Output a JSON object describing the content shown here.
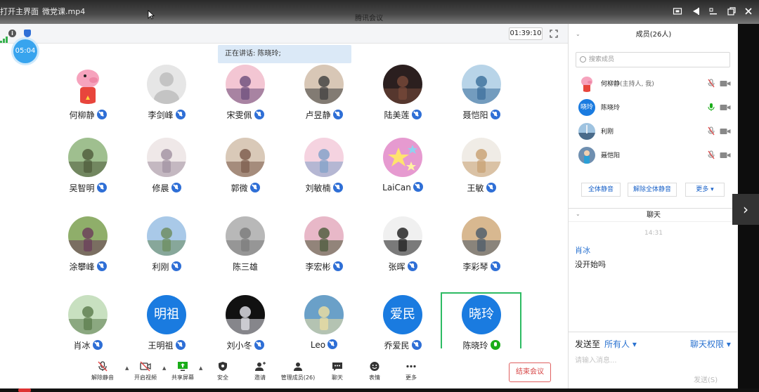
{
  "player": {
    "open_main": "打开主界面",
    "file_name": "微党课.mp4"
  },
  "app_title": "腾讯会议",
  "meeting": {
    "duration": "01:39:10",
    "timer_badge": "05:04",
    "speaking_banner": "正在讲话: 陈晓玲;"
  },
  "participants": [
    {
      "name": "何柳静",
      "mic": "muted",
      "avatar": "peppa"
    },
    {
      "name": "李剑峰",
      "mic": "muted",
      "avatar": "default"
    },
    {
      "name": "宋雯佩",
      "mic": "muted",
      "avatar": "photo"
    },
    {
      "name": "卢昱静",
      "mic": "muted",
      "avatar": "photo"
    },
    {
      "name": "陆美莲",
      "mic": "muted",
      "avatar": "photo"
    },
    {
      "name": "聂恺阳",
      "mic": "muted",
      "avatar": "photo"
    },
    {
      "name": "吴智明",
      "mic": "muted",
      "avatar": "photo"
    },
    {
      "name": "修晨",
      "mic": "muted",
      "avatar": "photo"
    },
    {
      "name": "郭微",
      "mic": "muted",
      "avatar": "photo"
    },
    {
      "name": "刘敏楠",
      "mic": "muted",
      "avatar": "photo"
    },
    {
      "name": "LaiCan",
      "mic": "muted",
      "avatar": "stars"
    },
    {
      "name": "王敏",
      "mic": "muted",
      "avatar": "photo"
    },
    {
      "name": "涂攀峰",
      "mic": "muted",
      "avatar": "photo"
    },
    {
      "name": "利刚",
      "mic": "muted",
      "avatar": "photo"
    },
    {
      "name": "陈三雄",
      "mic": "none",
      "avatar": "photo"
    },
    {
      "name": "李宏彬",
      "mic": "muted",
      "avatar": "photo"
    },
    {
      "name": "张晖",
      "mic": "muted",
      "avatar": "photo"
    },
    {
      "name": "李彩琴",
      "mic": "muted",
      "avatar": "photo"
    },
    {
      "name": "肖冰",
      "mic": "muted",
      "avatar": "photo"
    },
    {
      "name": "王明祖",
      "mic": "muted",
      "avatar": "text",
      "avatar_text": "明祖"
    },
    {
      "name": "刘小冬",
      "mic": "muted",
      "avatar": "photo"
    },
    {
      "name": "Leo",
      "mic": "muted",
      "avatar": "photo"
    },
    {
      "name": "乔爱民",
      "mic": "muted",
      "avatar": "text",
      "avatar_text": "爱民"
    },
    {
      "name": "陈晓玲",
      "mic": "on",
      "avatar": "text",
      "avatar_text": "晓玲"
    }
  ],
  "toolbar": {
    "unmute": "解除静音",
    "start_video": "开启视频",
    "share_screen": "共享屏幕",
    "security": "安全",
    "invite": "邀请",
    "manage_members": "管理成员(26)",
    "chat": "聊天",
    "reactions": "表情",
    "more": "更多",
    "end_meeting": "结束会议"
  },
  "side": {
    "members_title": "成员(26人)",
    "search_placeholder": "搜索成员",
    "members": [
      {
        "name": "何柳静",
        "note": "(主持人, 我)",
        "mic": "muted"
      },
      {
        "name": "陈晓玲",
        "note": "",
        "mic": "on",
        "avatar_text": "晓玲"
      },
      {
        "name": "利刚",
        "note": "",
        "mic": "muted"
      },
      {
        "name": "聂恺阳",
        "note": "",
        "mic": "muted"
      }
    ],
    "mute_all": "全体静音",
    "unmute_all": "解除全体静音",
    "more": "更多 ▾",
    "chat_title": "聊天",
    "chat_time": "14:31",
    "chat_sender": "肖冰",
    "chat_text": "没开始吗",
    "send_to_label": "发送至",
    "send_to_target": "所有人 ▾",
    "chat_permission": "聊天权限 ▾",
    "input_placeholder": "请输入消息...",
    "send_button": "发送(S)"
  },
  "colors": {
    "accent": "#1a7be0",
    "speaking": "#2dbb63",
    "end_meeting": "#d64545"
  }
}
